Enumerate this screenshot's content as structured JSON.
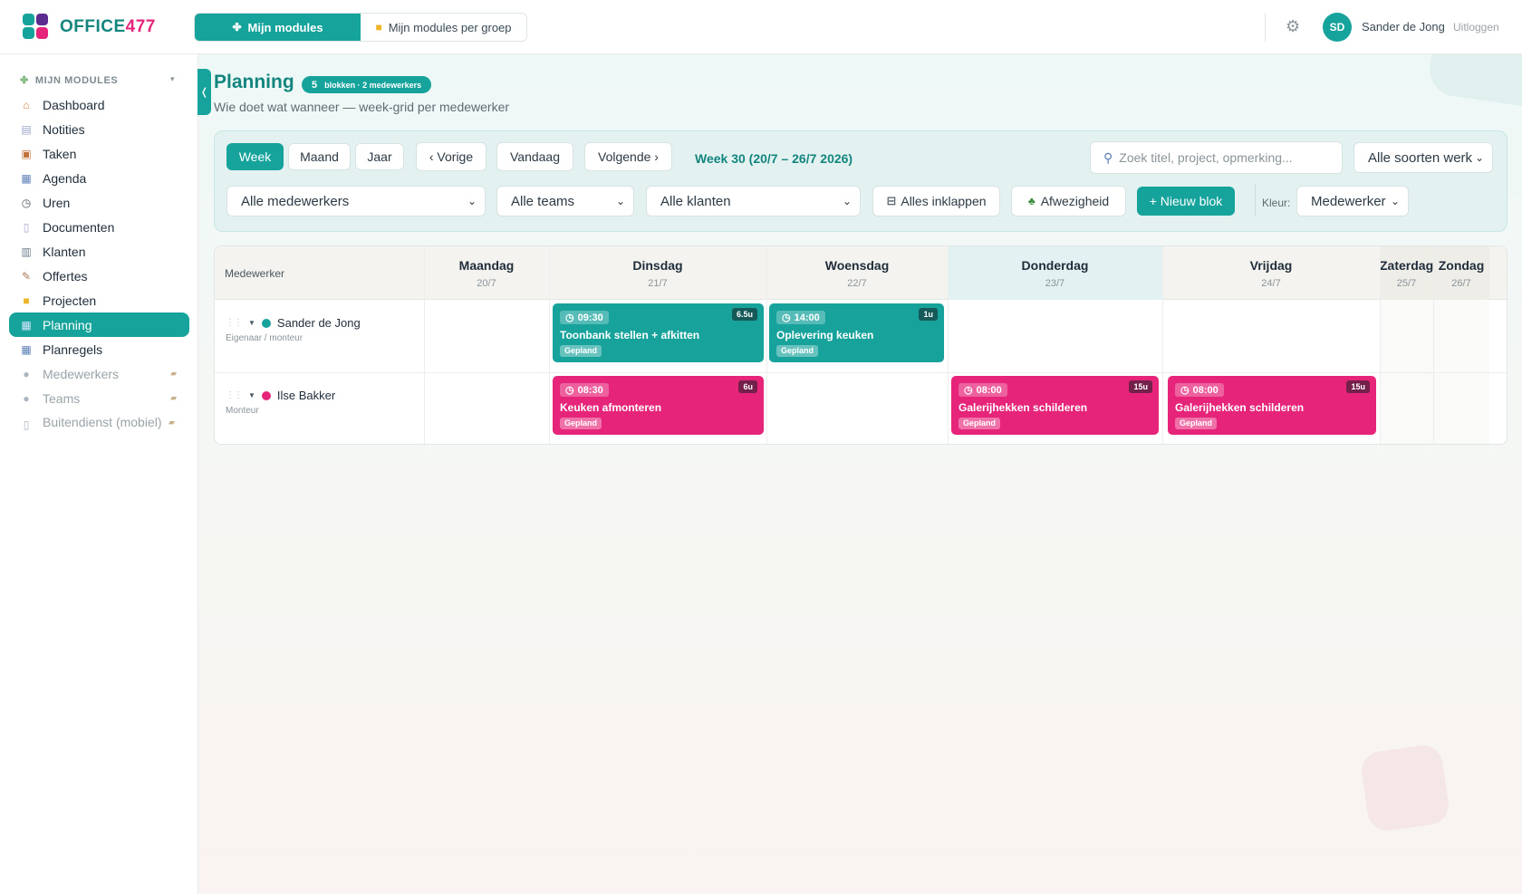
{
  "app": {
    "brand_prefix": "OFFICE",
    "brand_suffix": "477"
  },
  "topnav": [
    {
      "label": "Mijn modules",
      "icon": "puzzle-icon",
      "active": true
    },
    {
      "label": "Mijn modules per groep",
      "icon": "folder-icon",
      "active": false
    }
  ],
  "user": {
    "initials": "SD",
    "name": "Sander de Jong",
    "logout": "Uitloggen"
  },
  "sidebar": {
    "header": "MIJN MODULES",
    "items": [
      {
        "label": "Dashboard",
        "icon": "house-icon"
      },
      {
        "label": "Notities",
        "icon": "note-icon"
      },
      {
        "label": "Taken",
        "icon": "clipboard-icon"
      },
      {
        "label": "Agenda",
        "icon": "calendar-icon"
      },
      {
        "label": "Uren",
        "icon": "clock-icon"
      },
      {
        "label": "Documenten",
        "icon": "document-icon"
      },
      {
        "label": "Klanten",
        "icon": "building-icon"
      },
      {
        "label": "Offertes",
        "icon": "pen-paper-icon"
      },
      {
        "label": "Projecten",
        "icon": "folder-icon"
      },
      {
        "label": "Planning",
        "icon": "calendar-icon",
        "active": true
      },
      {
        "label": "Planregels",
        "icon": "calendar-icon"
      },
      {
        "label": "Medewerkers",
        "icon": "user-icon",
        "locked": true
      },
      {
        "label": "Teams",
        "icon": "users-icon",
        "locked": true
      },
      {
        "label": "Buitendienst (mobiel)",
        "icon": "phone-icon",
        "locked": true
      }
    ]
  },
  "page": {
    "title": "Planning",
    "badge_count": "5",
    "badge_text": "blokken · 2 medewerkers",
    "subtitle": "Wie doet wat wanneer — week-grid per medewerker"
  },
  "toolbar": {
    "views": [
      "Week",
      "Maand",
      "Jaar"
    ],
    "active_view": "Week",
    "prev": "‹ Vorige",
    "today": "Vandaag",
    "next": "Volgende ›",
    "week_label": "Week 30 (20/7 – 26/7 2026)",
    "search_placeholder": "Zoek titel, project, opmerking...",
    "work_type": "Alle soorten werk",
    "employees": "Alle medewerkers",
    "teams": "Alle teams",
    "clients": "Alle klanten",
    "collapse_all": "Alles inklappen",
    "absence": "Afwezigheid",
    "new_block": "+ Nieuw blok",
    "color_label": "Kleur:",
    "color_value": "Medewerker"
  },
  "grid": {
    "employee_header": "Medewerker",
    "days": [
      {
        "name": "Maandag",
        "date": "20/7"
      },
      {
        "name": "Dinsdag",
        "date": "21/7"
      },
      {
        "name": "Woensdag",
        "date": "22/7"
      },
      {
        "name": "Donderdag",
        "date": "23/7",
        "today": true
      },
      {
        "name": "Vrijdag",
        "date": "24/7"
      },
      {
        "name": "Zaterdag",
        "date": "25/7",
        "weekend": true
      },
      {
        "name": "Zondag",
        "date": "26/7",
        "weekend": true
      }
    ],
    "employees": [
      {
        "name": "Sander de Jong",
        "role": "Eigenaar / monteur",
        "color": "#17a29c"
      },
      {
        "name": "Ilse Bakker",
        "role": "Monteur",
        "color": "#e6257a"
      }
    ],
    "blocks": [
      {
        "employee": 0,
        "day": 1,
        "time": "09:30",
        "duration": "6.5u",
        "title": "Toonbank stellen + afkitten",
        "status": "Gepland",
        "color": "teal"
      },
      {
        "employee": 0,
        "day": 2,
        "time": "14:00",
        "duration": "1u",
        "title": "Oplevering keuken",
        "status": "Gepland",
        "color": "teal"
      },
      {
        "employee": 1,
        "day": 1,
        "time": "08:30",
        "duration": "6u",
        "title": "Keuken afmonteren",
        "status": "Gepland",
        "color": "pink"
      },
      {
        "employee": 1,
        "day": 3,
        "time": "08:00",
        "duration": "15u",
        "title": "Galerijhekken schilderen",
        "status": "Gepland",
        "color": "pink"
      },
      {
        "employee": 1,
        "day": 4,
        "time": "08:00",
        "duration": "15u",
        "title": "Galerijhekken schilderen",
        "status": "Gepland",
        "color": "pink"
      }
    ]
  },
  "colors": {
    "accent": "#16a39c",
    "pink": "#e6257a",
    "brand_dark": "#13857f"
  }
}
